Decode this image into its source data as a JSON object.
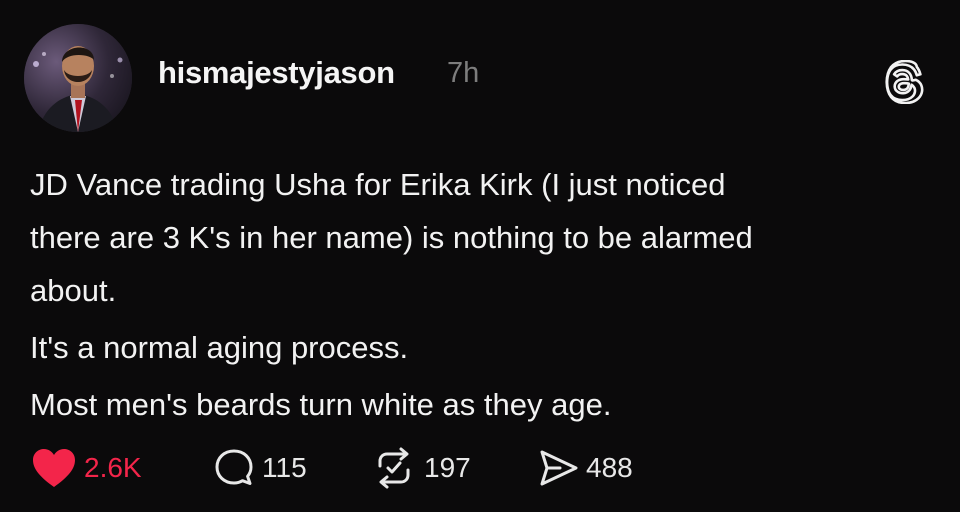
{
  "post": {
    "username": "hismajestyjason",
    "timestamp": "7h",
    "paragraphs": [
      "JD Vance trading Usha for Erika Kirk (I just noticed",
      "there are 3 K's in her name) is nothing to be alarmed",
      "about.",
      "It's a normal aging process.",
      "Most men's beards turn white as they age."
    ]
  },
  "actions": {
    "likes": "2.6K",
    "replies": "115",
    "reposts": "197",
    "shares": "488"
  },
  "icons": {
    "like": "heart-icon",
    "reply": "speech-bubble-icon",
    "repost": "repost-arrows-icon",
    "share": "send-icon",
    "brand": "threads-logo-icon"
  },
  "colors": {
    "background": "#0b0a0b",
    "text": "#f2f2f2",
    "muted": "#7d7d7d",
    "like": "#f3254a"
  }
}
